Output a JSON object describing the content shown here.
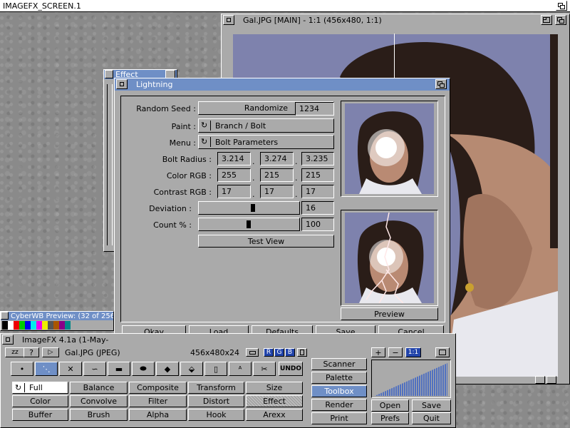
{
  "screen": {
    "title": "IMAGEFX_SCREEN.1"
  },
  "main_image_window": {
    "title": "Gal.JPG [MAIN] - 1:1 (456x480, 1:1)"
  },
  "effect_window": {
    "title": "Effect"
  },
  "cyberwb_window": {
    "title": "CyberWB Preview: (32 of 256"
  },
  "palette_colors": [
    "#000000",
    "#ffffff",
    "#ee0000",
    "#00cc00",
    "#0000ee",
    "#00eeee",
    "#ee00ee",
    "#eeee00",
    "#555555",
    "#aa5500",
    "#880088",
    "#008888"
  ],
  "lightning": {
    "title": "Lightning",
    "random_seed": {
      "label": "Random Seed :",
      "button": "Randomize",
      "value": "1234"
    },
    "paint": {
      "label": "Paint :",
      "value": "Branch / Bolt"
    },
    "menu": {
      "label": "Menu :",
      "value": "Bolt Parameters"
    },
    "bolt_radius": {
      "label": "Bolt Radius :",
      "values": [
        "3.214",
        "3.274",
        "3.235"
      ]
    },
    "color_rgb": {
      "label": "Color RGB :",
      "values": [
        "255",
        "215",
        "215"
      ]
    },
    "contrast_rgb": {
      "label": "Contrast RGB :",
      "values": [
        "17",
        "17",
        "17"
      ]
    },
    "deviation": {
      "label": "Deviation :",
      "value": "16",
      "fraction": 0.55
    },
    "count": {
      "label": "Count % :",
      "value": "100",
      "fraction": 0.5
    },
    "separator": ".",
    "test_view": "Test View",
    "preview": "Preview",
    "footer": [
      "Okay",
      "Load",
      "Defaults",
      "Save",
      "Cancel"
    ]
  },
  "toolbox": {
    "title": "ImageFX 4.1a (1-May-",
    "zz_button": "zz",
    "help_button": "?",
    "buffer_name": "Gal.JPG (JPEG)",
    "dimensions": "456x480x24",
    "rgb": [
      "R",
      "G",
      "B"
    ],
    "undo": "UNDO",
    "tools": [
      "dot-tool-icon",
      "freehand-tool-icon",
      "line-tool-icon",
      "curve-tool-icon",
      "box-tool-icon",
      "ellipse-tool-icon",
      "fill-tool-icon",
      "airbrush-tool-icon",
      "clipboard-tool-icon",
      "text-tool-icon",
      "cut-tool-icon"
    ],
    "full": "Full",
    "grid": [
      [
        "Balance",
        "Composite",
        "Transform",
        "Size"
      ],
      [
        "Color",
        "Convolve",
        "Filter",
        "Distort",
        "Effect"
      ],
      [
        "Buffer",
        "Brush",
        "Alpha",
        "Hook",
        "Arexx"
      ]
    ],
    "side": [
      "Scanner",
      "Palette",
      "Toolbox",
      "Render",
      "Print"
    ],
    "zoom": [
      "+",
      "−",
      "1:1"
    ],
    "bottom": [
      [
        "Open",
        "Save"
      ],
      [
        "Prefs",
        "Quit"
      ]
    ]
  }
}
